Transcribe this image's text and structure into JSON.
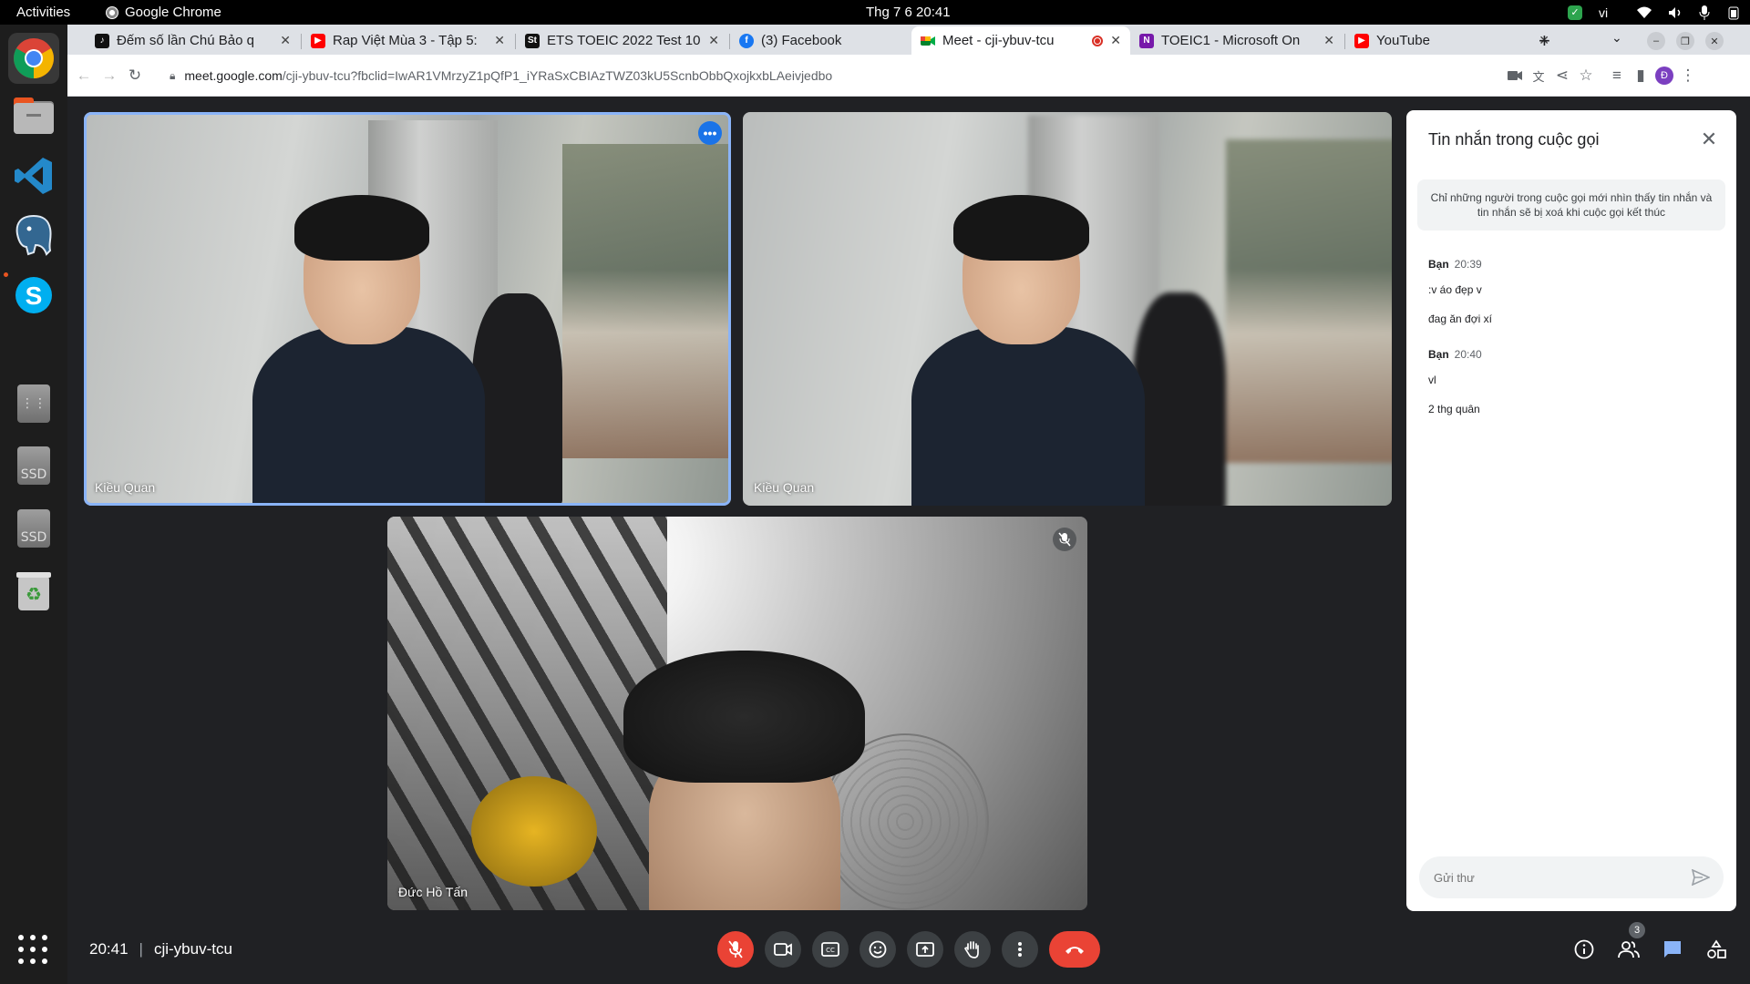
{
  "topbar": {
    "activities": "Activities",
    "app_name": "Google Chrome",
    "clock": "Thg 7 6  20:41",
    "lang": "vi"
  },
  "chrome": {
    "tabs": [
      {
        "title": "Đếm số lần Chú Bảo q",
        "favicon": "tiktok-icon",
        "active": false
      },
      {
        "title": "Rap Việt Mùa 3 - Tập 5:",
        "favicon": "youtube-icon",
        "active": false
      },
      {
        "title": "ETS TOEIC 2022 Test 10",
        "favicon": "st-icon",
        "active": false
      },
      {
        "title": "(3) Facebook",
        "favicon": "facebook-icon",
        "active": false
      },
      {
        "title": "Meet - cji-ybuv-tcu",
        "favicon": "meet-icon",
        "active": true
      },
      {
        "title": "TOEIC1 - Microsoft On",
        "favicon": "onenote-icon",
        "active": false
      },
      {
        "title": "YouTube",
        "favicon": "youtube-icon",
        "active": false
      }
    ],
    "url_host": "meet.google.com",
    "url_path": "/cji-ybuv-tcu?fbclid=IwAR1VMrzyZ1pQfP1_iYRaSxCBIAzTWZ03kU5ScnbObbQxojkxbLAeivjedbo",
    "profile_initial": "Đ"
  },
  "meet": {
    "tiles": [
      {
        "name": "Kiều Quan"
      },
      {
        "name": "Kiều Quan"
      },
      {
        "name": "Đức Hồ Tấn"
      }
    ],
    "time": "20:41",
    "meeting_code": "cji-ybuv-tcu",
    "participant_count": "3"
  },
  "chat": {
    "title": "Tin nhắn trong cuộc gọi",
    "notice": "Chỉ những người trong cuộc gọi mới nhìn thấy tin nhắn và tin nhắn sẽ bị xoá khi cuộc gọi kết thúc",
    "groups": [
      {
        "sender": "Bạn",
        "time": "20:39",
        "messages": [
          ":v áo đẹp v",
          "đag ăn đợi xí"
        ]
      },
      {
        "sender": "Bạn",
        "time": "20:40",
        "messages": [
          "vl",
          "2 thg quân"
        ]
      }
    ],
    "input_placeholder": "Gửi thư"
  },
  "colors": {
    "meet_bg": "#202124",
    "accent": "#8ab4f8",
    "end_call": "#ea4335"
  }
}
